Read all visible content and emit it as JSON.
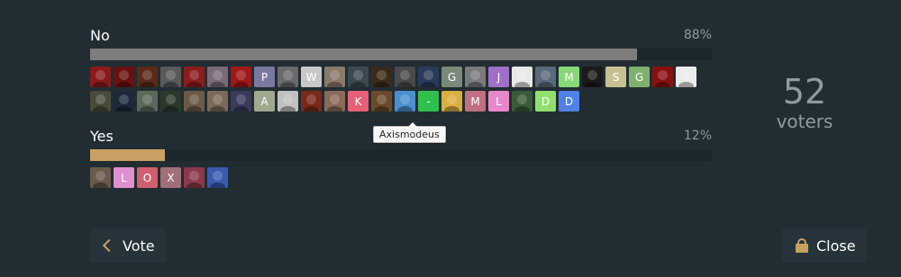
{
  "poll": {
    "options": [
      {
        "label": "No",
        "percent_text": "88%",
        "percent": 88,
        "bar_color": "#7d7d7d",
        "voters": [
          {
            "letter": "",
            "color": "#8a1a1a"
          },
          {
            "letter": "",
            "color": "#6a1010"
          },
          {
            "letter": "",
            "color": "#5a2a1a"
          },
          {
            "letter": "",
            "color": "#5a5a5a"
          },
          {
            "letter": "",
            "color": "#8a1c1c"
          },
          {
            "letter": "",
            "color": "#7a6a7a"
          },
          {
            "letter": "",
            "color": "#a01818"
          },
          {
            "letter": "P",
            "color": "#7878a0"
          },
          {
            "letter": "",
            "color": "#6a6a6a"
          },
          {
            "letter": "W",
            "color": "#c8c8c8"
          },
          {
            "letter": "",
            "color": "#8a7a6a"
          },
          {
            "letter": "",
            "color": "#3a4a50"
          },
          {
            "letter": "",
            "color": "#3a2a1a"
          },
          {
            "letter": "",
            "color": "#4a4a4a"
          },
          {
            "letter": "",
            "color": "#2a3a5a"
          },
          {
            "letter": "G",
            "color": "#7a8a7a"
          },
          {
            "letter": "",
            "color": "#7a7a7a"
          },
          {
            "letter": "J",
            "color": "#a070c8"
          },
          {
            "letter": "",
            "color": "#e8e8e8"
          },
          {
            "letter": "",
            "color": "#5a6a7a"
          },
          {
            "letter": "M",
            "color": "#88d878"
          },
          {
            "letter": "",
            "color": "#1a1a1a"
          },
          {
            "letter": "S",
            "color": "#c8c090"
          },
          {
            "letter": "G",
            "color": "#80b070"
          },
          {
            "letter": "",
            "color": "#8a1010"
          },
          {
            "letter": "",
            "color": "#ececec"
          },
          {
            "letter": "",
            "color": "#4a4a3a"
          },
          {
            "letter": "",
            "color": "#1a2a3a"
          },
          {
            "letter": "",
            "color": "#5a6a5a"
          },
          {
            "letter": "",
            "color": "#2a3a2a"
          },
          {
            "letter": "",
            "color": "#6a5a4a"
          },
          {
            "letter": "",
            "color": "#7a6a5a"
          },
          {
            "letter": "",
            "color": "#3a3a5a"
          },
          {
            "letter": "A",
            "color": "#a0a890"
          },
          {
            "letter": "",
            "color": "#c0c0c0"
          },
          {
            "letter": "",
            "color": "#7a2a1a"
          },
          {
            "letter": "",
            "color": "#8a6a5a"
          },
          {
            "letter": "K",
            "color": "#e86078"
          },
          {
            "letter": "",
            "color": "#6a4a2a"
          },
          {
            "letter": "",
            "color": "#4a90d0"
          },
          {
            "letter": "-",
            "color": "#30c050"
          },
          {
            "letter": "",
            "color": "#d8b040"
          },
          {
            "letter": "M",
            "color": "#c07080"
          },
          {
            "letter": "L",
            "color": "#e888c8"
          },
          {
            "letter": "",
            "color": "#3a5a3a"
          },
          {
            "letter": "D",
            "color": "#90e070"
          },
          {
            "letter": "D",
            "color": "#5080e8"
          }
        ]
      },
      {
        "label": "Yes",
        "percent_text": "12%",
        "percent": 12,
        "bar_color": "#c9a063",
        "voters": [
          {
            "letter": "",
            "color": "#6a5a4a"
          },
          {
            "letter": "L",
            "color": "#e090d0"
          },
          {
            "letter": "O",
            "color": "#d06070"
          },
          {
            "letter": "X",
            "color": "#a07078"
          },
          {
            "letter": "",
            "color": "#8a3a4a"
          },
          {
            "letter": "",
            "color": "#3a5ab0"
          }
        ]
      }
    ]
  },
  "tooltip": {
    "text": "Axismodeus"
  },
  "summary": {
    "count": "52",
    "label": "voters"
  },
  "buttons": {
    "vote_label": "Vote",
    "close_label": "Close"
  },
  "colors": {
    "background": "#212d32",
    "accent": "#c8a060"
  }
}
